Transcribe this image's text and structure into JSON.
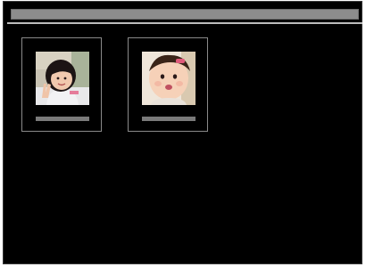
{
  "window": {
    "title": ""
  },
  "thumbnails": [
    {
      "label": "",
      "icon": "child-photo-icon"
    },
    {
      "label": "",
      "icon": "baby-photo-icon"
    }
  ],
  "colors": {
    "background": "#000000",
    "title_bar": "#8c8c8c",
    "tile_border": "#8a8a8a",
    "label_placeholder": "#7a7a7a"
  }
}
